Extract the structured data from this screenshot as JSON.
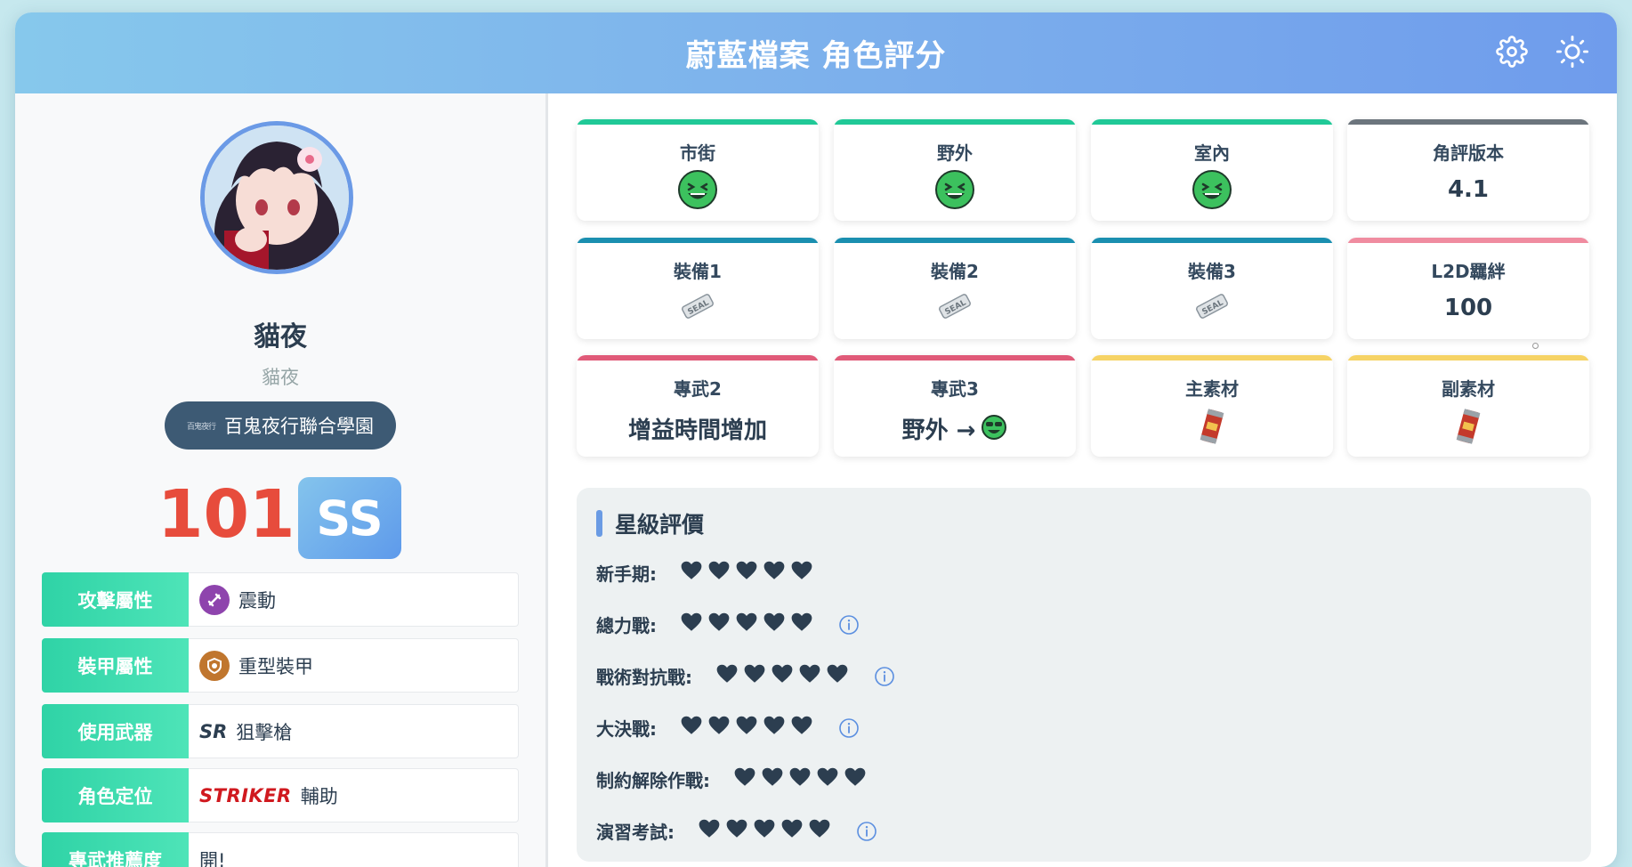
{
  "header": {
    "title": "蔚藍檔案 角色評分",
    "settings_icon": "gear-icon",
    "theme_icon": "sun-icon"
  },
  "character": {
    "name": "貓夜",
    "subname": "貓夜",
    "school": {
      "logo_text": "百鬼夜行",
      "name": "百鬼夜行聯合學園"
    },
    "score": "101",
    "grade": "SS",
    "info": [
      {
        "label": "攻擊屬性",
        "value": "震動",
        "icon": "vibration-icon",
        "icon_color": "#8e44ad"
      },
      {
        "label": "裝甲屬性",
        "value": "重型裝甲",
        "icon": "heavy-armor-icon",
        "icon_color": "#c0762e"
      },
      {
        "label": "使用武器",
        "tag": "SR",
        "value": "狙擊槍"
      },
      {
        "label": "角色定位",
        "tag": "STRIKER",
        "value": "輔助"
      },
      {
        "label": "專武推薦度",
        "value": "開!"
      }
    ]
  },
  "cards": [
    {
      "label": "市街",
      "icon": "grin-face-icon",
      "accent": "#20c997"
    },
    {
      "label": "野外",
      "icon": "grin-face-icon",
      "accent": "#20c997"
    },
    {
      "label": "室內",
      "icon": "grin-face-icon",
      "accent": "#20c997"
    },
    {
      "label": "角評版本",
      "value": "4.1",
      "accent": "#6c757d"
    },
    {
      "label": "裝備1",
      "icon": "sealed-equipment-icon",
      "accent": "#1a8fb0"
    },
    {
      "label": "裝備2",
      "icon": "sealed-equipment-icon",
      "accent": "#1a8fb0"
    },
    {
      "label": "裝備3",
      "icon": "sealed-equipment-icon",
      "accent": "#1a8fb0"
    },
    {
      "label": "L2D羈絆",
      "value": "100",
      "accent": "#f08ca0"
    },
    {
      "label": "專武2",
      "value": "增益時間增加",
      "accent": "#e05a78"
    },
    {
      "label": "專武3",
      "value": "野外 →",
      "icon": "sunglasses-face-icon",
      "accent": "#e05a78"
    },
    {
      "label": "主素材",
      "icon": "energy-drink-icon",
      "accent": "#f6d365"
    },
    {
      "label": "副素材",
      "icon": "energy-drink-icon",
      "accent": "#f6d365"
    }
  ],
  "star_rating": {
    "title": "星級評價",
    "rows": [
      {
        "label": "新手期:",
        "hearts": 5,
        "info": false
      },
      {
        "label": "總力戰:",
        "hearts": 5,
        "info": true
      },
      {
        "label": "戰術對抗戰:",
        "hearts": 5,
        "info": true
      },
      {
        "label": "大決戰:",
        "hearts": 5,
        "info": true
      },
      {
        "label": "制約解除作戰:",
        "hearts": 5,
        "info": false
      },
      {
        "label": "演習考試:",
        "hearts": 5,
        "info": true
      }
    ]
  }
}
